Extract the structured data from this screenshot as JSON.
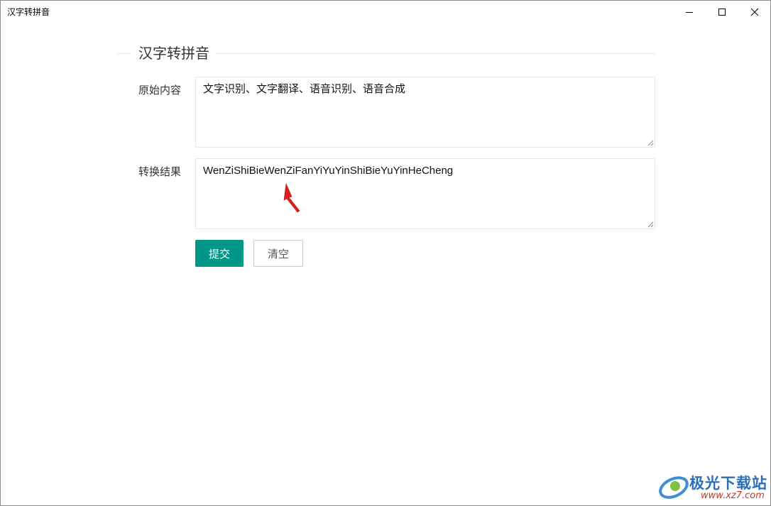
{
  "window": {
    "title": "汉字转拼音"
  },
  "form": {
    "legend": "汉字转拼音",
    "original_label": "原始内容",
    "original_value": "文字识别、文字翻译、语音识别、语音合成",
    "result_label": "转换结果",
    "result_value": "WenZiShiBieWenZiFanYiYuYinShiBieYuYinHeCheng"
  },
  "buttons": {
    "submit_label": "提交",
    "clear_label": "清空"
  },
  "watermark": {
    "brand": "极光下载站",
    "url": "www.xz7.com"
  },
  "colors": {
    "primary": "#009688",
    "arrow": "#e01b1b"
  },
  "icons": {
    "minimize": "minimize-icon",
    "maximize": "maximize-icon",
    "close": "close-icon",
    "arrow": "red-arrow-annotation"
  }
}
